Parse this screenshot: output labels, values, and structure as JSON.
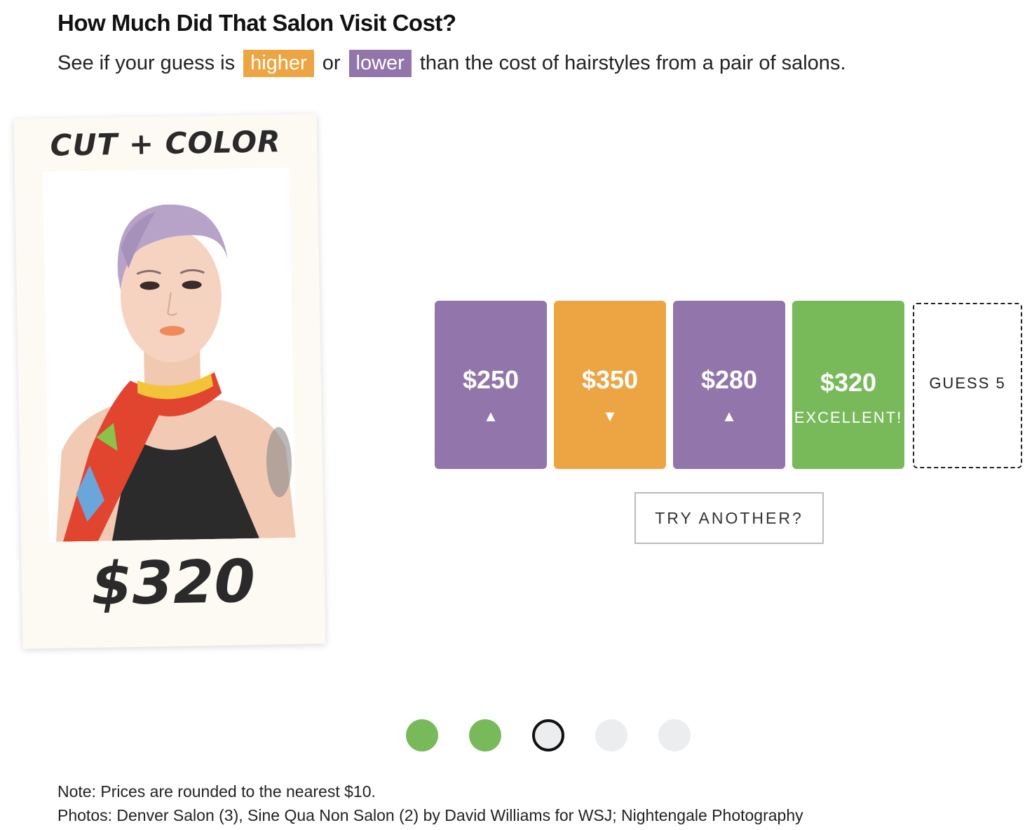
{
  "header": {
    "title": "How Much Did That Salon Visit Cost?",
    "subtitle_pre": "See if your guess is",
    "higher_label": "higher",
    "or_text": "or",
    "lower_label": "lower",
    "subtitle_post": "than the cost of hairstyles from a pair of salons."
  },
  "card": {
    "label": "CUT + COLOR",
    "price": "$320"
  },
  "guesses": [
    {
      "amount": "$250",
      "arrow": "▲",
      "color": "#9175AB"
    },
    {
      "amount": "$350",
      "arrow": "▼",
      "color": "#ECA542"
    },
    {
      "amount": "$280",
      "arrow": "▲",
      "color": "#9175AB"
    },
    {
      "amount": "$320",
      "verdict": "EXCELLENT!",
      "color": "#78BA5A"
    }
  ],
  "next_guess_label": "GUESS 5",
  "try_another_label": "TRY ANOTHER?",
  "progress": {
    "total": 5,
    "completed": 2,
    "current": 3
  },
  "footer": {
    "note": "Note: Prices are rounded to the nearest $10.",
    "photos": "Photos: Denver Salon (3), Sine Qua Non Salon (2) by David Williams for WSJ; Nightengale Photography"
  },
  "colors": {
    "higher": "#ECA542",
    "lower": "#9175AB",
    "correct": "#78BA5A",
    "dot_pending": "#ECEDEF"
  }
}
